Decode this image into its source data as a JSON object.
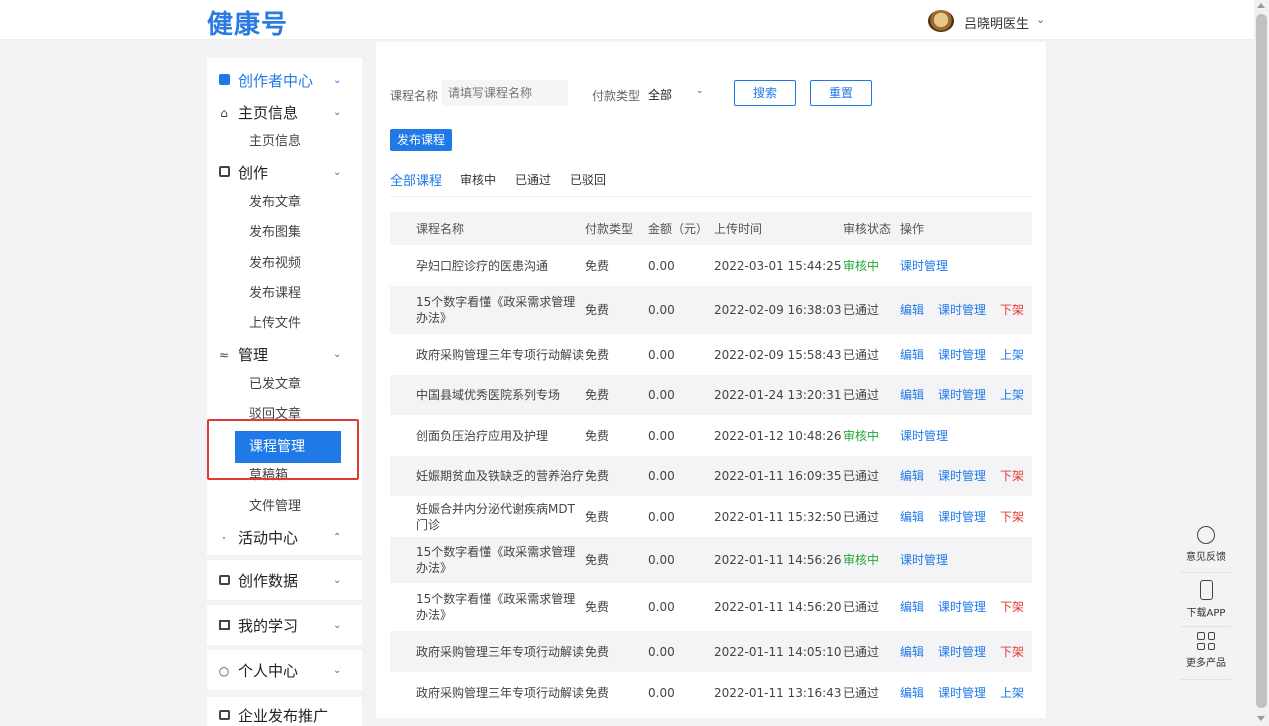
{
  "header": {
    "logo": "健康号",
    "user_name": "吕晓明医生",
    "chevron": "⌄"
  },
  "sidebar": {
    "creator_center": "创作者中心",
    "home_info": "主页信息",
    "home_info_sub": "主页信息",
    "create": "创作",
    "create_items": [
      "发布文章",
      "发布图集",
      "发布视频",
      "发布课程",
      "上传文件"
    ],
    "manage": "管理",
    "manage_items": [
      "已发文章",
      "驳回文章",
      "课程管理",
      "草稿箱",
      "文件管理"
    ],
    "activity": "活动中心",
    "creation_data": "创作数据",
    "my_learning": "我的学习",
    "personal_center": "个人中心",
    "enterprise": "企业发布推广"
  },
  "filters": {
    "course_name_label": "课程名称",
    "course_name_placeholder": "请填写课程名称",
    "pay_type_label": "付款类型",
    "pay_type_value": "全部",
    "search_label": "搜索",
    "reset_label": "重置",
    "publish_label": "发布课程"
  },
  "tabs": [
    "全部课程",
    "审核中",
    "已通过",
    "已驳回"
  ],
  "table": {
    "headers": [
      "课程名称",
      "付款类型",
      "金额（元）",
      "上传时间",
      "审核状态",
      "操作"
    ],
    "rows": [
      {
        "name": "孕妇口腔诊疗的医患沟通",
        "pay": "免费",
        "amount": "0.00",
        "time": "2022-03-01 15:44:25",
        "status": "审核中",
        "ops": [
          "课时管理"
        ]
      },
      {
        "name": "15个数字看懂《政采需求管理办法》",
        "pay": "免费",
        "amount": "0.00",
        "time": "2022-02-09 16:38:03",
        "status": "已通过",
        "ops": [
          "编辑",
          "课时管理",
          "下架"
        ]
      },
      {
        "name": "政府采购管理三年专项行动解读",
        "pay": "免费",
        "amount": "0.00",
        "time": "2022-02-09 15:58:43",
        "status": "已通过",
        "ops": [
          "编辑",
          "课时管理",
          "上架"
        ]
      },
      {
        "name": "中国县域优秀医院系列专场",
        "pay": "免费",
        "amount": "0.00",
        "time": "2022-01-24 13:20:31",
        "status": "已通过",
        "ops": [
          "编辑",
          "课时管理",
          "上架"
        ]
      },
      {
        "name": "创面负压治疗应用及护理",
        "pay": "免费",
        "amount": "0.00",
        "time": "2022-01-12 10:48:26",
        "status": "审核中",
        "ops": [
          "课时管理"
        ]
      },
      {
        "name": "妊娠期贫血及铁缺乏的营养治疗",
        "pay": "免费",
        "amount": "0.00",
        "time": "2022-01-11 16:09:35",
        "status": "已通过",
        "ops": [
          "编辑",
          "课时管理",
          "下架"
        ]
      },
      {
        "name": "妊娠合并内分泌代谢疾病MDT门诊",
        "pay": "免费",
        "amount": "0.00",
        "time": "2022-01-11 15:32:50",
        "status": "已通过",
        "ops": [
          "编辑",
          "课时管理",
          "下架"
        ]
      },
      {
        "name": "15个数字看懂《政采需求管理办法》",
        "pay": "免费",
        "amount": "0.00",
        "time": "2022-01-11 14:56:26",
        "status": "审核中",
        "ops": [
          "课时管理"
        ]
      },
      {
        "name": "15个数字看懂《政采需求管理办法》",
        "pay": "免费",
        "amount": "0.00",
        "time": "2022-01-11 14:56:20",
        "status": "已通过",
        "ops": [
          "编辑",
          "课时管理",
          "下架"
        ]
      },
      {
        "name": "政府采购管理三年专项行动解读",
        "pay": "免费",
        "amount": "0.00",
        "time": "2022-01-11 14:05:10",
        "status": "已通过",
        "ops": [
          "编辑",
          "课时管理",
          "下架"
        ]
      },
      {
        "name": "政府采购管理三年专项行动解读",
        "pay": "免费",
        "amount": "0.00",
        "time": "2022-01-11 13:16:43",
        "status": "已通过",
        "ops": [
          "编辑",
          "课时管理",
          "上架"
        ]
      }
    ]
  },
  "float_bar": {
    "feedback": "意见反馈",
    "download": "下载APP",
    "more": "更多产品"
  },
  "colors": {
    "accent": "#1f7ae8",
    "approved_green": "#21a938",
    "danger_red": "#e53935",
    "highlight_box": "#e53935"
  }
}
